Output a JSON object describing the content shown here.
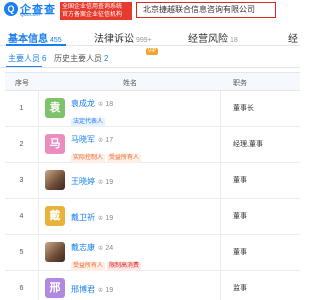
{
  "header": {
    "logo_mark": "Q",
    "logo_text": "企查查",
    "logo_domain": "Qcc.com",
    "slogan_line1": "全国企业信用查询系统",
    "slogan_line2": "官方备案企业征信机构",
    "company_name": "北京捷越联合信息咨询有限公司"
  },
  "tabs": [
    {
      "label": "基本信息",
      "count": "455"
    },
    {
      "label": "法律诉讼",
      "count": "999+"
    },
    {
      "label": "经营风险",
      "count": "18"
    },
    {
      "label": "经",
      "count": ""
    }
  ],
  "vip_badge": "VIP",
  "subtabs": [
    {
      "label": "主要人员",
      "count": "6"
    },
    {
      "label": "历史主要人员",
      "count": "2"
    }
  ],
  "table": {
    "headers": {
      "index": "序号",
      "name": "姓名",
      "role": "职务"
    },
    "rows": [
      {
        "index": "1",
        "avatar": "袁",
        "avatar_color": "#7ec36b",
        "name": "袁成龙",
        "count": "18",
        "tags": [
          {
            "text": "法定代表人",
            "style": "blue"
          }
        ],
        "role": "董事长"
      },
      {
        "index": "2",
        "avatar": "马",
        "avatar_color": "#ea8ec1",
        "name": "马晓军",
        "count": "17",
        "tags": [
          {
            "text": "实际控制人",
            "style": "orange"
          },
          {
            "text": "受益所有人",
            "style": "orange"
          }
        ],
        "role": "经理,董事"
      },
      {
        "index": "3",
        "avatar": "",
        "avatar_color": "",
        "name": "王晓婷",
        "count": "19",
        "tags": [],
        "role": "董事"
      },
      {
        "index": "4",
        "avatar": "戴",
        "avatar_color": "#e9b23b",
        "name": "戴卫祈",
        "count": "19",
        "tags": [],
        "role": "董事"
      },
      {
        "index": "5",
        "avatar": "",
        "avatar_color": "",
        "name": "戴志康",
        "count": "24",
        "tags": [
          {
            "text": "受益所有人",
            "style": "orange"
          },
          {
            "text": "限制高消费",
            "style": "red"
          }
        ],
        "role": "董事"
      },
      {
        "index": "6",
        "avatar": "邢",
        "avatar_color": "#b18ae0",
        "name": "邢博君",
        "count": "19",
        "tags": [],
        "role": "监事"
      }
    ]
  }
}
